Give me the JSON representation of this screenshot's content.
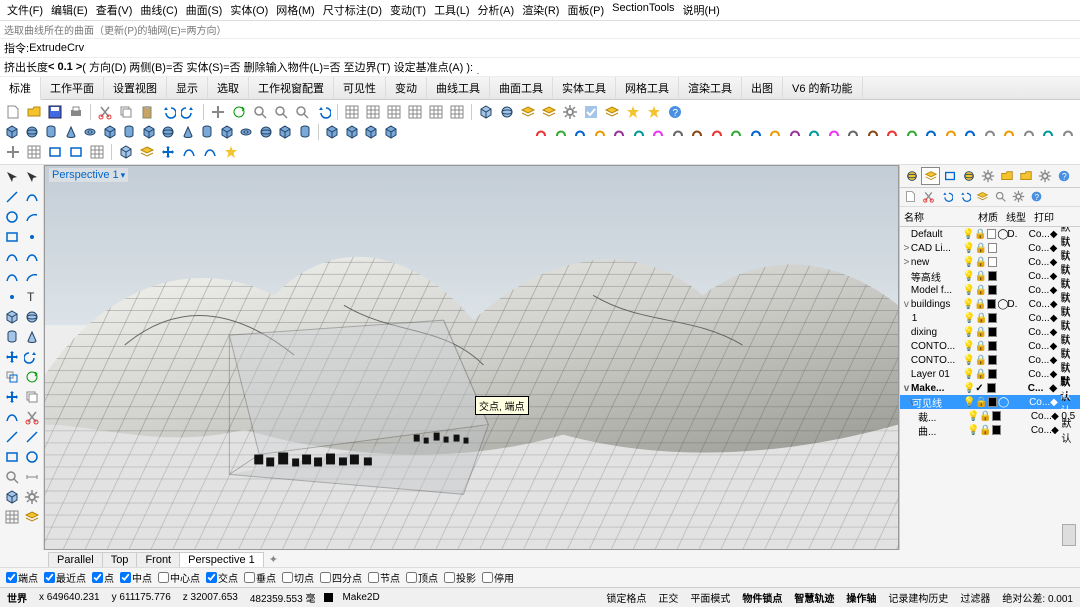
{
  "menu": [
    "文件(F)",
    "编辑(E)",
    "查看(V)",
    "曲线(C)",
    "曲面(S)",
    "实体(O)",
    "网格(M)",
    "尺寸标注(D)",
    "变动(T)",
    "工具(L)",
    "分析(A)",
    "渲染(R)",
    "面板(P)",
    "SectionTools",
    "说明(H)"
  ],
  "cmd_hint": "选取曲线所在的曲面（更新(P)的轴网(E)=两方向）",
  "cmd_label1": "指令: ",
  "cmd_name": "ExtrudeCrv",
  "cmd_label2": "挤出长度 ",
  "cmd_val": "< 0.1 >",
  "cmd_opts": " ( 方向(D)  两侧(B)=否  实体(S)=否  删除输入物件(L)=否  至边界(T)  设定基准点(A) ):",
  "tabs": [
    "标准",
    "工作平面",
    "设置视图",
    "显示",
    "选取",
    "工作视窗配置",
    "可见性",
    "变动",
    "曲线工具",
    "曲面工具",
    "实体工具",
    "网格工具",
    "渲染工具",
    "出图",
    "V6 的新功能"
  ],
  "viewport_title": "Perspective 1",
  "vp_tooltip": "交点, 端点",
  "panel_hdr": {
    "c1": "名称",
    "c2": "材质",
    "c3": "线型",
    "c4": "打印"
  },
  "layers": [
    {
      "exp": "",
      "ind": 0,
      "name": "Default",
      "mat": "D.",
      "lt": "Co...",
      "pr": "默认",
      "sw": "#fff",
      "circ": true
    },
    {
      "exp": ">",
      "ind": 0,
      "name": "CAD Li...",
      "mat": "",
      "lt": "Co...",
      "pr": "默认",
      "sw": "#fff"
    },
    {
      "exp": ">",
      "ind": 0,
      "name": "new",
      "mat": "",
      "lt": "Co...",
      "pr": "默认",
      "sw": "#fff"
    },
    {
      "exp": "",
      "ind": 0,
      "name": "等高线",
      "mat": "",
      "lt": "Co...",
      "pr": "默认",
      "sw": "#000"
    },
    {
      "exp": "",
      "ind": 0,
      "name": "Model f...",
      "mat": "",
      "lt": "Co...",
      "pr": "默认",
      "sw": "#000"
    },
    {
      "exp": "v",
      "ind": 0,
      "name": "buildings",
      "mat": "D.",
      "lt": "Co...",
      "pr": "默认",
      "sw": "#000",
      "circ": true
    },
    {
      "exp": "",
      "ind": 1,
      "name": "1",
      "mat": "",
      "lt": "Co...",
      "pr": "默认",
      "sw": "#000"
    },
    {
      "exp": "",
      "ind": 0,
      "name": "dixing",
      "mat": "",
      "lt": "Co...",
      "pr": "默认",
      "sw": "#000"
    },
    {
      "exp": "",
      "ind": 0,
      "name": "CONTO...",
      "mat": "",
      "lt": "Co...",
      "pr": "默认",
      "sw": "#000"
    },
    {
      "exp": "",
      "ind": 0,
      "name": "CONTO...",
      "mat": "",
      "lt": "Co...",
      "pr": "默认",
      "sw": "#000"
    },
    {
      "exp": "",
      "ind": 0,
      "name": "Layer 01",
      "mat": "",
      "lt": "Co...",
      "pr": "默认",
      "sw": "#000"
    },
    {
      "exp": "v",
      "ind": 0,
      "name": "Make...",
      "mat": "",
      "lt": "C...",
      "pr": "默认",
      "sw": "#000",
      "bold": true,
      "chk": true
    },
    {
      "exp": "v",
      "ind": 1,
      "name": "可见线",
      "mat": "",
      "lt": "Co...",
      "pr": "默认",
      "sw": "#000",
      "sel": true,
      "circ": true
    },
    {
      "exp": "",
      "ind": 2,
      "name": "裁...",
      "mat": "",
      "lt": "Co...",
      "pr": "0.5",
      "sw": "#000"
    },
    {
      "exp": "",
      "ind": 2,
      "name": "曲...",
      "mat": "",
      "lt": "Co...",
      "pr": "默认",
      "sw": "#000"
    }
  ],
  "viewtabs": [
    "Parallel",
    "Top",
    "Front",
    "Perspective 1"
  ],
  "osnap": [
    {
      "l": "端点",
      "c": true
    },
    {
      "l": "最近点",
      "c": true
    },
    {
      "l": "点",
      "c": true
    },
    {
      "l": "中点",
      "c": true
    },
    {
      "l": "中心点",
      "c": false
    },
    {
      "l": "交点",
      "c": true
    },
    {
      "l": "垂点",
      "c": false
    },
    {
      "l": "切点",
      "c": false
    },
    {
      "l": "四分点",
      "c": false
    },
    {
      "l": "节点",
      "c": false
    },
    {
      "l": "顶点",
      "c": false
    },
    {
      "l": "投影",
      "c": false
    },
    {
      "l": "停用",
      "c": false
    }
  ],
  "status": {
    "world": "世界",
    "x": "x 649640.231",
    "y": "y 611175.776",
    "z": "z 32007.653",
    "mm": "482359.553 毫",
    "layer": "Make2D",
    "items": [
      "锁定格点",
      "正交",
      "平面模式",
      "物件锁点",
      "智慧轨迹",
      "操作轴",
      "记录建构历史",
      "过滤器"
    ],
    "tol": "绝对公差: 0.001"
  },
  "chart_data": {
    "type": "other"
  }
}
